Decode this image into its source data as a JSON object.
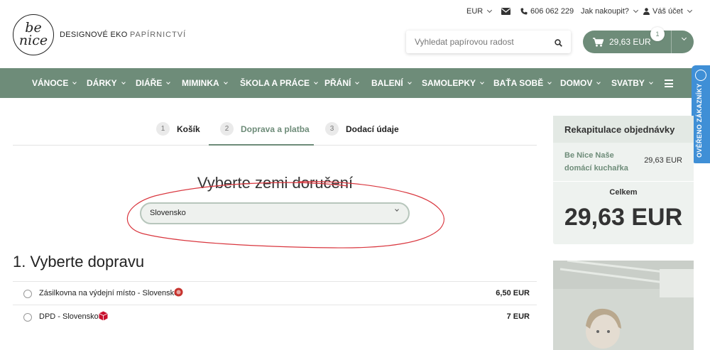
{
  "topbar": {
    "currency": "EUR",
    "phone": "606 062 229",
    "how_to_buy": "Jak nakoupit?",
    "account": "Váš účet"
  },
  "logo": {
    "mark_line1": "be",
    "mark_line2": "nice",
    "name": "DESIGNOVÉ EKO",
    "suffix": "PAPÍRNICTVÍ"
  },
  "search": {
    "placeholder": "Vyhledat papírovou radost"
  },
  "cart": {
    "amount": "29,63 EUR",
    "count": "1"
  },
  "nav": {
    "items": [
      "VÁNOCE",
      "DÁRKY",
      "DIÁŘE",
      "MIMINKA",
      "ŠKOLA A PRÁCE",
      "PŘÁNÍ",
      "BALENÍ",
      "SAMOLEPKY",
      "BAŤA SOBĚ",
      "DOMOV",
      "SVATBY"
    ]
  },
  "side_tab": {
    "label": "OVĚŘENO ZÁKAZNÍKY"
  },
  "steps": [
    {
      "num": "1",
      "label": "Košík"
    },
    {
      "num": "2",
      "label": "Doprava a platba"
    },
    {
      "num": "3",
      "label": "Dodací údaje"
    }
  ],
  "country": {
    "title": "Vyberte zemi doručení",
    "selected": "Slovensko"
  },
  "shipping": {
    "title": "1. Vyberte dopravu",
    "options": [
      {
        "label": "Zásilkovna na výdejní místo - Slovensko",
        "price": "6,50 EUR",
        "icon": "zasilkovna-icon"
      },
      {
        "label": "DPD - Slovensko",
        "price": "7 EUR",
        "icon": "dpd-icon"
      }
    ]
  },
  "summary": {
    "title": "Rekapitulace objednávky",
    "product_name": "Be Nice Naše domácí kuchařka",
    "product_price": "29,63 EUR",
    "total_label": "Celkem",
    "total": "29,63 EUR"
  },
  "colors": {
    "brand_green": "#6e8c79",
    "scribble_red": "#d9363e",
    "side_tab_blue": "#3f8fd6"
  }
}
